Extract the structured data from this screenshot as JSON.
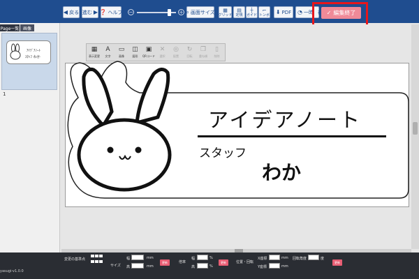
{
  "toolbar": {
    "back": "戻る",
    "forward": "進む",
    "help": "ヘルプ",
    "zoom_minus": "−",
    "zoom_plus": "+",
    "canvas_size": "画面サイズ",
    "grid": "グリッド",
    "ruler": "定規",
    "guide": "ガイド",
    "trim": "トンボ",
    "pdf": "PDF",
    "temp_save": "一時",
    "temp_save_suffix": "存",
    "finish": "編集終了"
  },
  "pages_panel": {
    "tabs": [
      "Page一覧",
      "画像"
    ],
    "thumbnail": {
      "line1": "ｱｲﾃﾞｱﾉｰﾄ",
      "line2": "ｽﾀｯﾌ わか",
      "page_number": "1"
    }
  },
  "tools": [
    {
      "label": "表示変更",
      "icon": "display-change-icon",
      "glyph": "▦",
      "enabled": true
    },
    {
      "label": "文字",
      "icon": "text-icon",
      "glyph": "A",
      "enabled": true
    },
    {
      "label": "画像",
      "icon": "image-icon",
      "glyph": "▭",
      "enabled": true
    },
    {
      "label": "図形",
      "icon": "shape-icon",
      "glyph": "◫",
      "enabled": true
    },
    {
      "label": "QRコード",
      "icon": "qr-code-icon",
      "glyph": "▣",
      "enabled": true
    },
    {
      "label": "選択",
      "icon": "select-icon",
      "glyph": "✕",
      "enabled": false
    },
    {
      "label": "配置",
      "icon": "arrange-icon",
      "glyph": "◎",
      "enabled": false
    },
    {
      "label": "回転",
      "icon": "rotate-icon",
      "glyph": "↻",
      "enabled": false
    },
    {
      "label": "重ね順",
      "icon": "layer-order-icon",
      "glyph": "❐",
      "enabled": false
    },
    {
      "label": "削除",
      "icon": "delete-icon",
      "glyph": "▯",
      "enabled": false
    }
  ],
  "design": {
    "title": "アイデアノート",
    "role": "スタッフ",
    "name": "わか"
  },
  "properties": {
    "anchor_label": "変更の基準点",
    "size_label": "サイズ",
    "width_label": "幅",
    "height_label": "高",
    "mm": "mm",
    "ratio_label": "倍率",
    "percent": "%",
    "position_label": "位置・回転",
    "x_label": "X座標",
    "y_label": "Y座標",
    "rotation_label": "回転角度",
    "degree": "度",
    "apply": "更新"
  },
  "footer": {
    "version": "yasugi-v1.0.0"
  },
  "colors": {
    "toolbar_bg": "#1f4d8f",
    "finish_button": "#f08a98",
    "highlight": "#e8161b",
    "apply_button": "#e85d73"
  }
}
